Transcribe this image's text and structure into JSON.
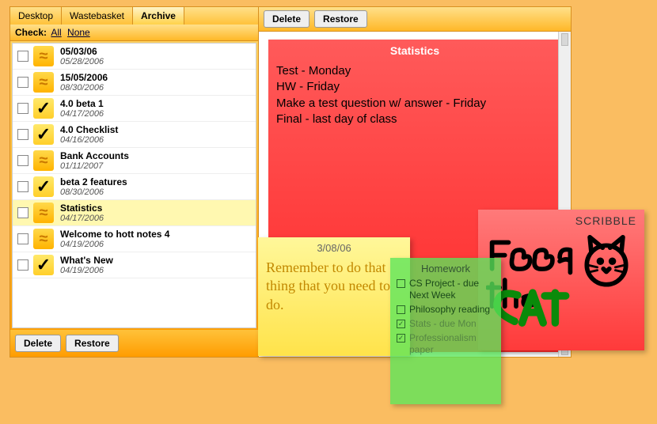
{
  "tabs": {
    "items": [
      "Desktop",
      "Wastebasket",
      "Archive"
    ],
    "active": "Archive"
  },
  "check": {
    "label": "Check:",
    "all": "All",
    "none": "None"
  },
  "notes": [
    {
      "title": "05/03/06",
      "date": "05/28/2006",
      "icon": "wave"
    },
    {
      "title": "15/05/2006",
      "date": "08/30/2006",
      "icon": "wave"
    },
    {
      "title": "4.0 beta 1",
      "date": "04/17/2006",
      "icon": "check"
    },
    {
      "title": "4.0 Checklist",
      "date": "04/16/2006",
      "icon": "check"
    },
    {
      "title": "Bank Accounts",
      "date": "01/11/2007",
      "icon": "wave"
    },
    {
      "title": "beta 2 features",
      "date": "08/30/2006",
      "icon": "check"
    },
    {
      "title": "Statistics",
      "date": "04/17/2006",
      "icon": "wave",
      "selected": true
    },
    {
      "title": "Welcome to hott notes 4",
      "date": "04/19/2006",
      "icon": "wave"
    },
    {
      "title": "What's New",
      "date": "04/19/2006",
      "icon": "check"
    }
  ],
  "buttons": {
    "delete": "Delete",
    "restore": "Restore"
  },
  "preview": {
    "title": "Statistics",
    "lines": [
      "Test - Monday",
      "HW - Friday",
      "Make a test question w/ answer - Friday",
      "Final - last day of class"
    ]
  },
  "sticky_yellow": {
    "header": "3/08/06",
    "body": "Remember to do that thing that you need to do."
  },
  "sticky_green": {
    "header": "Homework",
    "items": [
      {
        "text": "CS Project - due Next Week",
        "done": false
      },
      {
        "text": "Philosophy reading",
        "done": false
      },
      {
        "text": "Stats - due Mon",
        "done": true
      },
      {
        "text": "Professionalism paper",
        "done": true
      }
    ]
  },
  "sticky_red": {
    "header": "SCRIBBLE",
    "drawing_label": "Feed the CAT"
  }
}
